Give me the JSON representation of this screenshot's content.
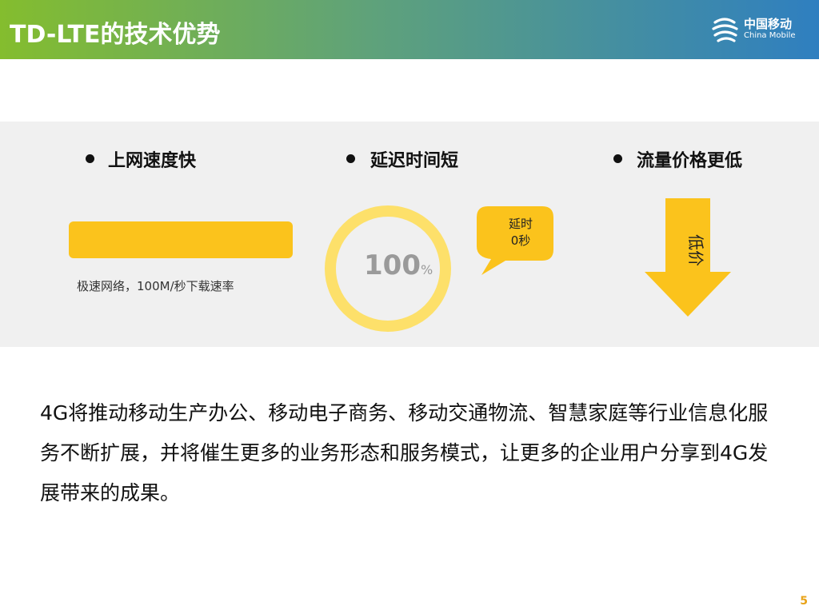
{
  "header": {
    "title": "TD-LTE的技术优势",
    "logo": {
      "name_cn": "中国移动",
      "name_en": "China Mobile"
    }
  },
  "colors": {
    "header_start": "#84bd2e",
    "header_end": "#2f7fc0",
    "accent_yellow": "#fbc31c",
    "ring_yellow": "#fde06a",
    "panel_bg": "#f0f0f0",
    "page_number": "#e8a318"
  },
  "advantages": [
    {
      "heading": "上网速度快",
      "caption": "极速网络，100M/秒下载速率",
      "visual": "bar"
    },
    {
      "heading": "延迟时间短",
      "value": "100",
      "unit": "%",
      "bubble_line1": "延时",
      "bubble_line2": "0秒",
      "visual": "ring"
    },
    {
      "heading": "流量价格更低",
      "arrow_label": "低价",
      "visual": "down-arrow-icon"
    }
  ],
  "body_text": "4G将推动移动生产办公、移动电子商务、移动交通物流、智慧家庭等行业信息化服务不断扩展，并将催生更多的业务形态和服务模式，让更多的企业用户分享到4G发展带来的成果。",
  "page_number": "5"
}
